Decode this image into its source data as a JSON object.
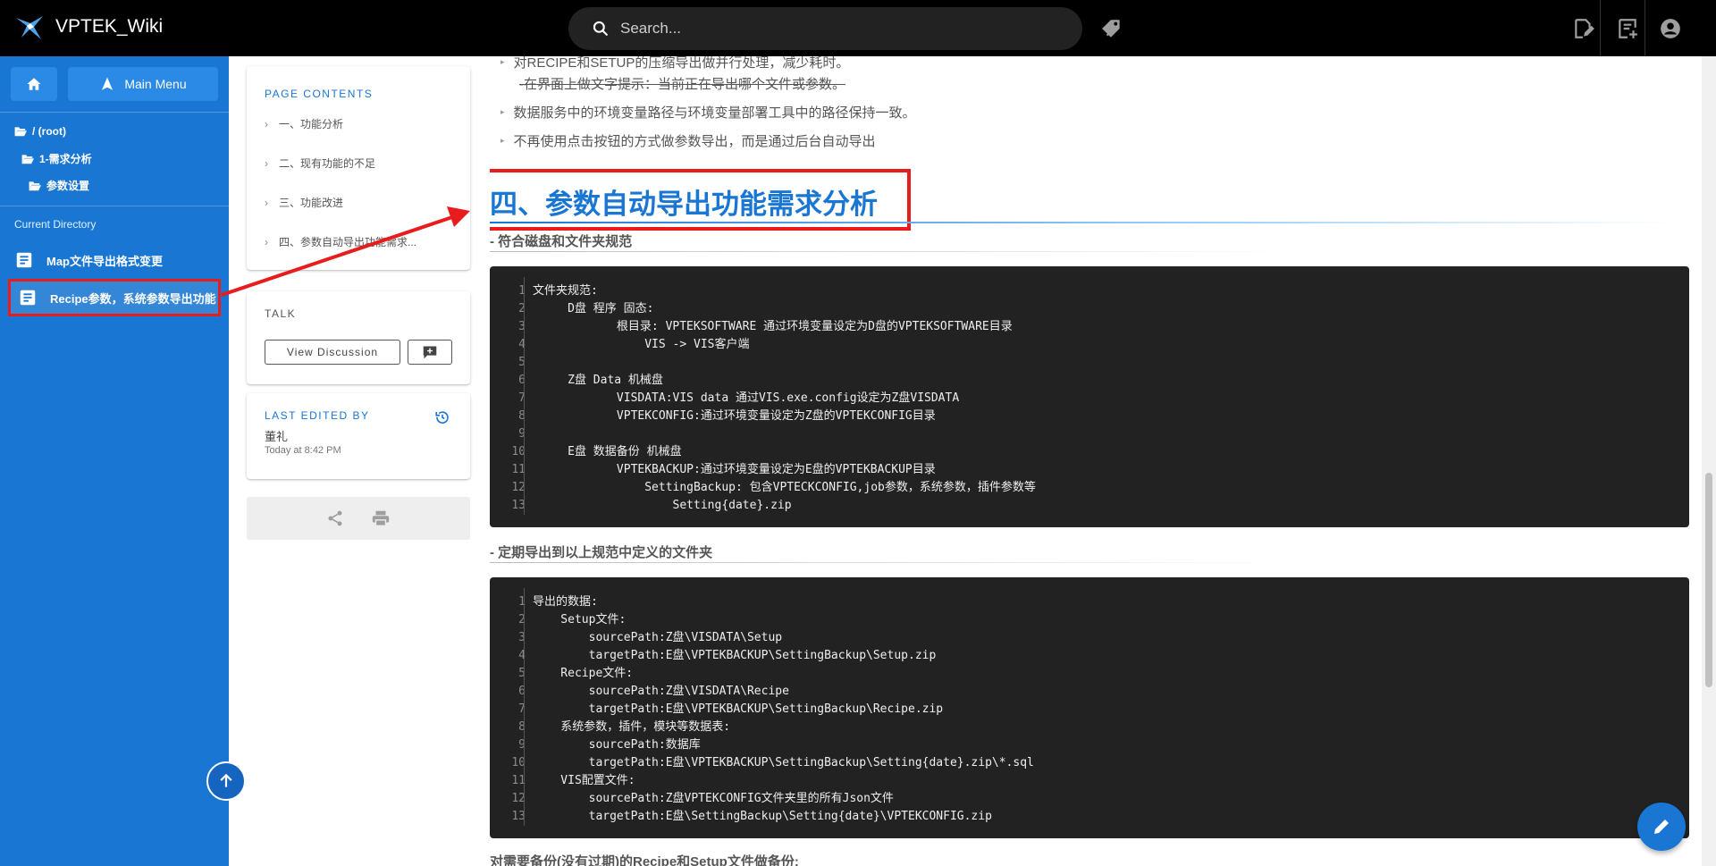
{
  "app": {
    "title": "VPTEK_Wiki"
  },
  "search": {
    "placeholder": "Search..."
  },
  "sidebar": {
    "main_menu": "Main Menu",
    "tree": [
      {
        "label": "/ (root)"
      },
      {
        "label": "1-需求分析"
      },
      {
        "label": "参数设置"
      }
    ],
    "current_directory": "Current Directory",
    "pages": [
      {
        "label": "Map文件导出格式变更"
      },
      {
        "label": "Recipe参数，系统参数导出功能"
      }
    ]
  },
  "page_contents": {
    "title": "PAGE CONTENTS",
    "items": [
      {
        "label": "一、功能分析"
      },
      {
        "label": "二、现有功能的不足"
      },
      {
        "label": "三、功能改进"
      },
      {
        "label": "四、参数自动导出功能需求..."
      }
    ]
  },
  "talk": {
    "title": "TALK",
    "view_discussion": "View Discussion"
  },
  "last_edited": {
    "title": "LAST EDITED BY",
    "user": "董礼",
    "time": "Today at 8:42 PM"
  },
  "content": {
    "bullets": [
      {
        "text": "对RECIPE和SETUP的压缩导出做并行处理，减少耗时。"
      },
      {
        "text": "-在界面上做文字提示：当前正在导出哪个文件或参数。"
      },
      {
        "text": "数据服务中的环境变量路径与环境变量部署工具中的路径保持一致。"
      },
      {
        "text": "不再使用点击按钮的方式做参数导出，而是通过后台自动导出"
      }
    ],
    "heading": "四、参数自动导出功能需求分析",
    "sub1": "- 符合磁盘和文件夹规范",
    "code1": [
      "文件夹规范:",
      "     D盘 程序 固态:",
      "            根目录: VPTEKSOFTWARE 通过环境变量设定为D盘的VPTEKSOFTWARE目录",
      "                VIS -> VIS客户端",
      "",
      "     Z盘 Data 机械盘",
      "            VISDATA:VIS data 通过VIS.exe.config设定为Z盘VISDATA",
      "            VPTEKCONFIG:通过环境变量设定为Z盘的VPTEKCONFIG目录",
      "",
      "     E盘 数据备份 机械盘",
      "            VPTEKBACKUP:通过环境变量设定为E盘的VPTEKBACKUP目录",
      "                SettingBackup: 包含VPTECKCONFIG,job参数，系统参数，插件参数等",
      "                    Setting{date}.zip"
    ],
    "sub2": "- 定期导出到以上规范中定义的文件夹",
    "code2": [
      "导出的数据:",
      "    Setup文件:",
      "        sourcePath:Z盘\\VISDATA\\Setup",
      "        targetPath:E盘\\VPTEKBACKUP\\SettingBackup\\Setup.zip",
      "    Recipe文件:",
      "        sourcePath:Z盘\\VISDATA\\Recipe",
      "        targetPath:E盘\\VPTEKBACKUP\\SettingBackup\\Recipe.zip",
      "    系统参数，插件，模块等数据表:",
      "        sourcePath:数据库",
      "        targetPath:E盘\\VPTEKBACKUP\\SettingBackup\\Setting{date}.zip\\*.sql",
      "    VIS配置文件:",
      "        sourcePath:Z盘VPTEKCONFIG文件夹里的所有Json文件",
      "        targetPath:E盘\\SettingBackup\\Setting{date}\\VPTEKCONFIG.zip"
    ],
    "bottom": "对需要备份(没有过期)的Recipe和Setup文件做备份:"
  },
  "colors": {
    "accent": "#1976d2",
    "highlight": "#e81c1c",
    "topbar": "#000000",
    "code_bg": "#222222"
  },
  "icons": [
    "logo-icon",
    "home-icon",
    "navigation-icon",
    "folder-icon",
    "page-icon",
    "search-icon",
    "tag-icon",
    "new-page-icon",
    "history-icon",
    "share-icon",
    "print-icon",
    "edit-icon",
    "arrow-up-icon",
    "comment-icon",
    "account-icon"
  ]
}
